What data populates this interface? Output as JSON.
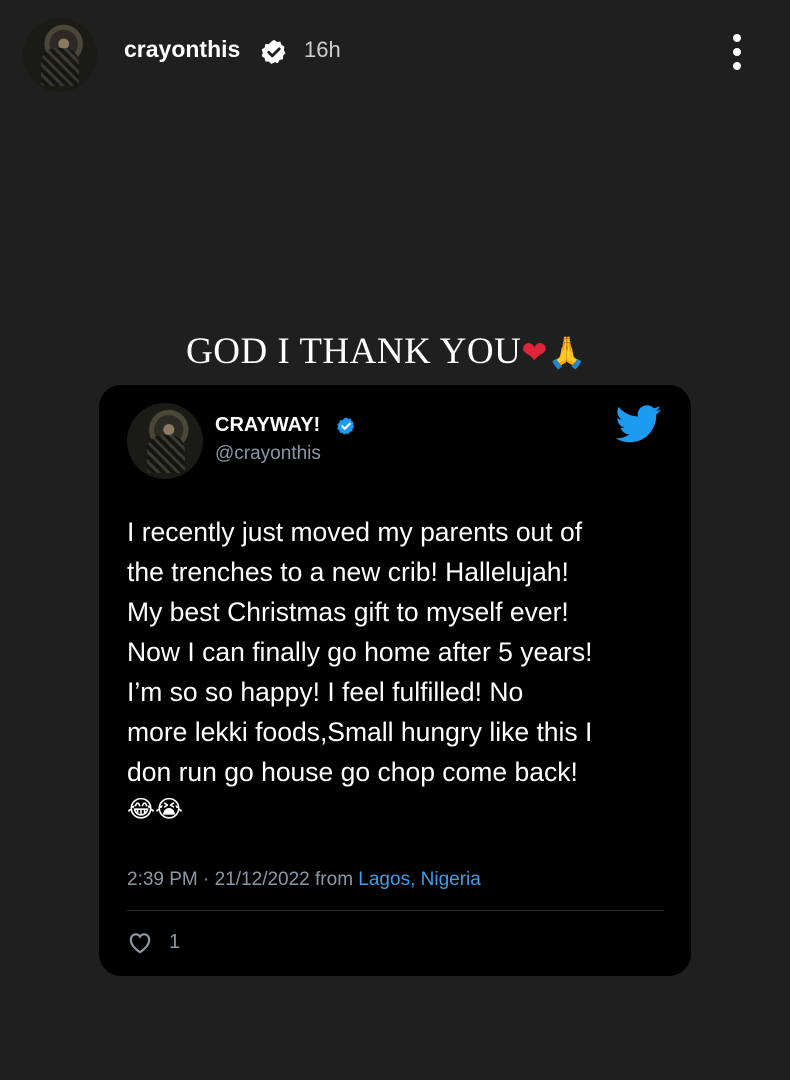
{
  "story": {
    "username": "crayonthis",
    "time": "16h",
    "caption_text": "GOD  I THANK YOU",
    "caption_heart": "❤",
    "caption_pray": "🙏"
  },
  "tweet": {
    "display_name": "CRAYWAY!",
    "handle": "@crayonthis",
    "lines": [
      "I recently just moved my parents out of",
      "the trenches to a new crib! Hallelujah!",
      "My best Christmas gift to myself ever!",
      "Now I can finally go home after 5 years!",
      "I’m so so happy! I feel fulfilled! No",
      "more lekki foods,Small hungry like this I",
      "don run go house go chop come back!"
    ],
    "emojis": "😂😭",
    "timestamp": "2:39 PM · 21/12/2022 from ",
    "location": "Lagos, Nigeria",
    "like_count": "1"
  },
  "colors": {
    "background": "#1f1f1f",
    "card": "#000000",
    "twitter_blue": "#1d9bf0",
    "link": "#3e9ee6",
    "muted": "#8b98a5"
  },
  "icons": [
    "verified-icon",
    "more-options-icon",
    "twitter-bird-icon",
    "heart-outline-icon"
  ]
}
